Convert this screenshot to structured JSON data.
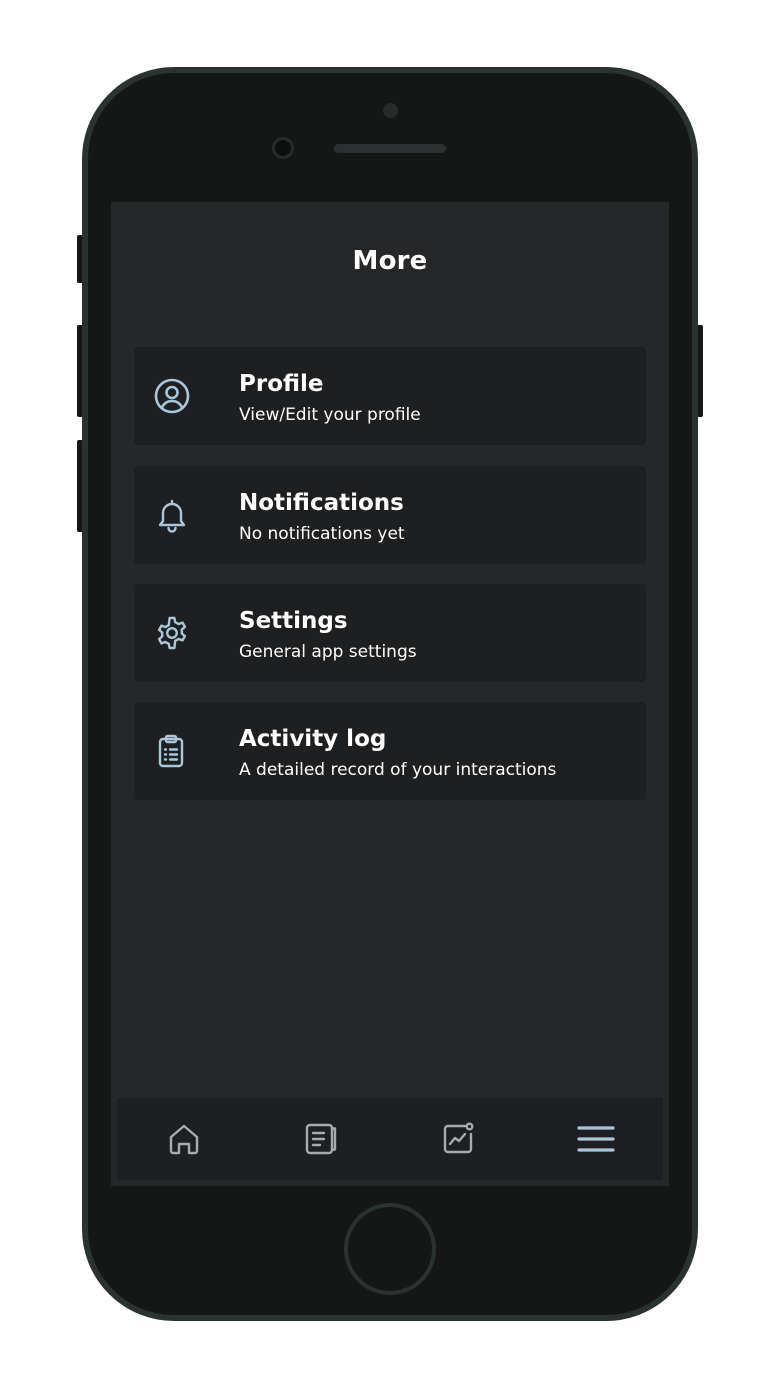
{
  "header": {
    "title": "More"
  },
  "menu": [
    {
      "label": "Profile",
      "description": "View/Edit your profile",
      "icon": "user-circle-icon"
    },
    {
      "label": "Notifications",
      "description": "No notifications yet",
      "icon": "bell-icon"
    },
    {
      "label": "Settings",
      "description": "General app settings",
      "icon": "gear-icon"
    },
    {
      "label": "Activity log",
      "description": "A detailed record of your interactions",
      "icon": "clipboard-list-icon"
    }
  ],
  "tabbar": [
    {
      "icon": "home-icon",
      "active": false
    },
    {
      "icon": "notebook-icon",
      "active": false
    },
    {
      "icon": "chart-badge-icon",
      "active": false
    },
    {
      "icon": "menu-icon",
      "active": true
    }
  ],
  "colors": {
    "background": "#252729",
    "card": "#1e1f20",
    "text": "#ffffff",
    "accent_icon": "#a9c7d8",
    "inactive_icon": "#a5abae"
  }
}
